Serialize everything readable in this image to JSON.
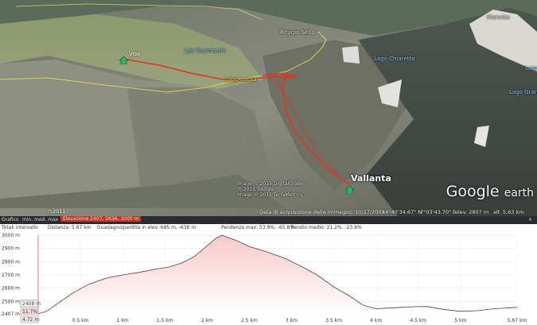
{
  "map": {
    "places": {
      "viso": "Viso",
      "piano_meda": "Las Piccimaule",
      "lago_lausa": "Lago Lausa",
      "rif_sella": "Rifugio Sella",
      "lago_chiaretto": "Lago Chiaretto",
      "vallanta": "Vallanta",
      "top_right": "Monviso",
      "right_a": "Lago",
      "right_b": "Lago Grande"
    },
    "attribution": [
      "Image © 2015 DigitalGlobe",
      "© 2015 Google",
      "Image © 2015 TerraMetrics"
    ],
    "year": "2011",
    "logo": {
      "brand": "Google",
      "suffix": "earth"
    },
    "status": {
      "acq_date": "Data di acquisizione delle immagini: 10/27/2005",
      "lat": "44°40'34.67\" N",
      "lon": "7°03'43.70\" E",
      "elev": "elev. 2807 m",
      "alt": "alt",
      "alt_value": "5.63 km"
    },
    "track_color": "#e8321f",
    "border_color": "#d8d25a"
  },
  "profile": {
    "row1": {
      "prefix": "Grafico",
      "minmax": "min. med. max",
      "elev_label": "Elevazione",
      "elev_values": "2407, 2636, 3000 m"
    },
    "row2": {
      "totals": "Totali intervallo",
      "distance": "Distanza: 5.67 km",
      "gain": "Guadagno/perdita in elev: 685 m, -636 m",
      "slope_max": "Pendenza max: 53.9%, -65.8%",
      "slope_avg": "Pendio medio: 21.2%, -23.8%"
    },
    "cursor_elev": "2408 m",
    "cursor_pct": "11.7%",
    "cursor_dist": "4.72 m"
  },
  "chart_data": {
    "type": "area",
    "ylabel": "m",
    "ylim": [
      2400,
      3000
    ],
    "xlim": [
      0,
      5.67
    ],
    "y_ticks": [
      "3000 m",
      "2900 m",
      "2800 m",
      "2700 m",
      "2600 m",
      "2500 m",
      "2407 m"
    ],
    "x_ticks": [
      "0.5 km",
      "1 km",
      "1.5 km",
      "2 km",
      "2.5 km",
      "3 km",
      "3.5 km",
      "4 km",
      "4.5 km",
      "5 km",
      "5.67 km"
    ],
    "x_tick_values": [
      0.5,
      1,
      1.5,
      2,
      2.5,
      3,
      3.5,
      4,
      4.5,
      5,
      5.67
    ],
    "x": [
      0,
      0.1,
      0.2,
      0.4,
      0.6,
      0.8,
      1.0,
      1.2,
      1.4,
      1.55,
      1.7,
      1.85,
      2.0,
      2.1,
      2.18,
      2.25,
      2.35,
      2.5,
      2.7,
      2.9,
      3.1,
      3.3,
      3.5,
      3.7,
      3.85,
      4.0,
      4.15,
      4.3,
      4.45,
      4.6,
      4.8,
      5.0,
      5.2,
      5.4,
      5.67
    ],
    "y": [
      2407,
      2425,
      2470,
      2560,
      2630,
      2675,
      2700,
      2720,
      2745,
      2760,
      2790,
      2840,
      2920,
      2975,
      3000,
      2980,
      2960,
      2915,
      2875,
      2830,
      2770,
      2700,
      2610,
      2535,
      2470,
      2445,
      2450,
      2455,
      2460,
      2462,
      2440,
      2425,
      2430,
      2445,
      2455
    ],
    "fill_top": "#f7c9c9",
    "fill_bottom": "#ffffff",
    "line_color": "#5a3a3a",
    "grid": true
  }
}
